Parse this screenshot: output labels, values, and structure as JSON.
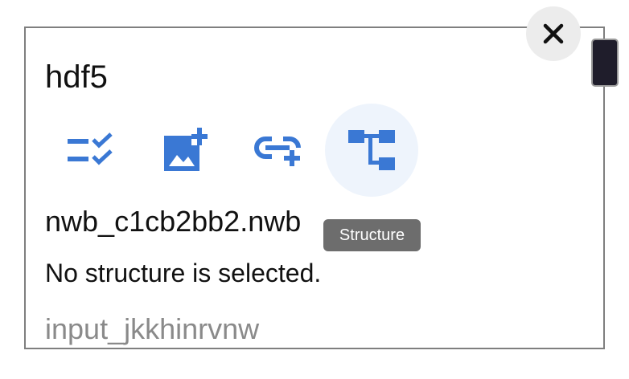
{
  "panel": {
    "title": "hdf5",
    "filename": "nwb_c1cb2bb2.nwb",
    "status": "No structure is selected.",
    "input": {
      "value": "",
      "placeholder": "input_jkkhinrvnw"
    }
  },
  "toolbar": {
    "buttons": [
      {
        "icon": "checklist-icon"
      },
      {
        "icon": "add-image-icon"
      },
      {
        "icon": "add-link-icon"
      },
      {
        "icon": "structure-tree-icon",
        "tooltip": "Structure",
        "active": true
      }
    ]
  },
  "colors": {
    "icon_blue": "#3a78d4",
    "active_bg": "#eef4fc",
    "close_bg": "#ececec",
    "tooltip_bg": "#616161",
    "border": "#7f7f7f"
  }
}
